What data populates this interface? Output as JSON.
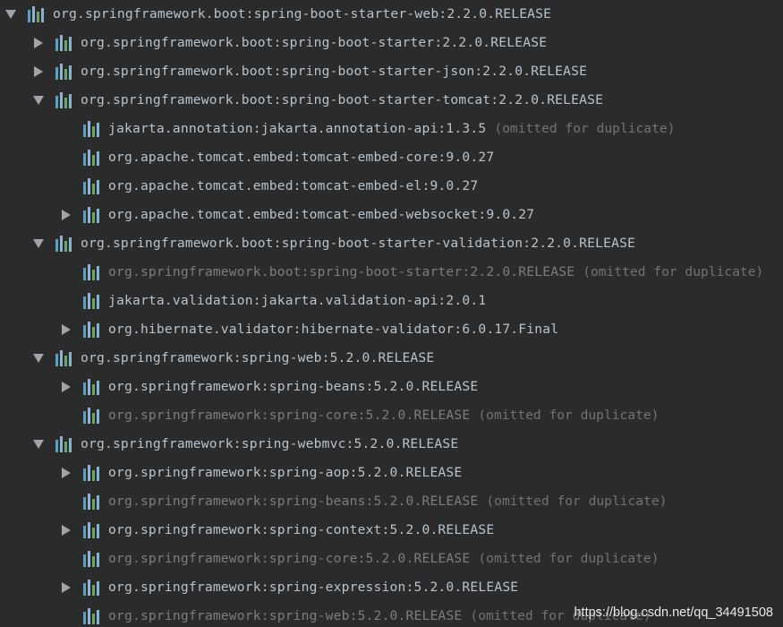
{
  "tree": {
    "rows": [
      {
        "label": "org.springframework.boot:spring-boot-starter-web:2.2.0.RELEASE",
        "toggle": "expanded",
        "level": 0,
        "omitted": false,
        "suffix": ""
      },
      {
        "label": "org.springframework.boot:spring-boot-starter:2.2.0.RELEASE",
        "toggle": "collapsed",
        "level": 1,
        "omitted": false,
        "suffix": ""
      },
      {
        "label": "org.springframework.boot:spring-boot-starter-json:2.2.0.RELEASE",
        "toggle": "collapsed",
        "level": 1,
        "omitted": false,
        "suffix": ""
      },
      {
        "label": "org.springframework.boot:spring-boot-starter-tomcat:2.2.0.RELEASE",
        "toggle": "expanded",
        "level": 1,
        "omitted": false,
        "suffix": ""
      },
      {
        "label": "jakarta.annotation:jakarta.annotation-api:1.3.5",
        "toggle": "none",
        "level": 2,
        "omitted": false,
        "suffix": "(omitted for duplicate)"
      },
      {
        "label": "org.apache.tomcat.embed:tomcat-embed-core:9.0.27",
        "toggle": "none",
        "level": 2,
        "omitted": false,
        "suffix": ""
      },
      {
        "label": "org.apache.tomcat.embed:tomcat-embed-el:9.0.27",
        "toggle": "none",
        "level": 2,
        "omitted": false,
        "suffix": ""
      },
      {
        "label": "org.apache.tomcat.embed:tomcat-embed-websocket:9.0.27",
        "toggle": "collapsed",
        "level": 2,
        "omitted": false,
        "suffix": ""
      },
      {
        "label": "org.springframework.boot:spring-boot-starter-validation:2.2.0.RELEASE",
        "toggle": "expanded",
        "level": 1,
        "omitted": false,
        "suffix": ""
      },
      {
        "label": "org.springframework.boot:spring-boot-starter:2.2.0.RELEASE",
        "toggle": "none",
        "level": 2,
        "omitted": true,
        "suffix": "(omitted for duplicate)"
      },
      {
        "label": "jakarta.validation:jakarta.validation-api:2.0.1",
        "toggle": "none",
        "level": 2,
        "omitted": false,
        "suffix": ""
      },
      {
        "label": "org.hibernate.validator:hibernate-validator:6.0.17.Final",
        "toggle": "collapsed",
        "level": 2,
        "omitted": false,
        "suffix": ""
      },
      {
        "label": "org.springframework:spring-web:5.2.0.RELEASE",
        "toggle": "expanded",
        "level": 1,
        "omitted": false,
        "suffix": ""
      },
      {
        "label": "org.springframework:spring-beans:5.2.0.RELEASE",
        "toggle": "collapsed",
        "level": 2,
        "omitted": false,
        "suffix": ""
      },
      {
        "label": "org.springframework:spring-core:5.2.0.RELEASE",
        "toggle": "none",
        "level": 2,
        "omitted": true,
        "suffix": "(omitted for duplicate)"
      },
      {
        "label": "org.springframework:spring-webmvc:5.2.0.RELEASE",
        "toggle": "expanded",
        "level": 1,
        "omitted": false,
        "suffix": ""
      },
      {
        "label": "org.springframework:spring-aop:5.2.0.RELEASE",
        "toggle": "collapsed",
        "level": 2,
        "omitted": false,
        "suffix": ""
      },
      {
        "label": "org.springframework:spring-beans:5.2.0.RELEASE",
        "toggle": "none",
        "level": 2,
        "omitted": true,
        "suffix": "(omitted for duplicate)"
      },
      {
        "label": "org.springframework:spring-context:5.2.0.RELEASE",
        "toggle": "collapsed",
        "level": 2,
        "omitted": false,
        "suffix": ""
      },
      {
        "label": "org.springframework:spring-core:5.2.0.RELEASE",
        "toggle": "none",
        "level": 2,
        "omitted": true,
        "suffix": "(omitted for duplicate)"
      },
      {
        "label": "org.springframework:spring-expression:5.2.0.RELEASE",
        "toggle": "collapsed",
        "level": 2,
        "omitted": false,
        "suffix": ""
      },
      {
        "label": "org.springframework:spring-web:5.2.0.RELEASE",
        "toggle": "none",
        "level": 2,
        "omitted": true,
        "suffix": "(omitted for duplicate)"
      }
    ]
  },
  "icons": {
    "toggle_expanded": "triangle-down-icon",
    "toggle_collapsed": "triangle-right-icon",
    "library": "library-icon"
  },
  "colors": {
    "background": "#2b2b2b",
    "text": "#b9c3cc",
    "omitted_text": "#7a7e82"
  },
  "watermark": "https://blog.csdn.net/qq_34491508"
}
